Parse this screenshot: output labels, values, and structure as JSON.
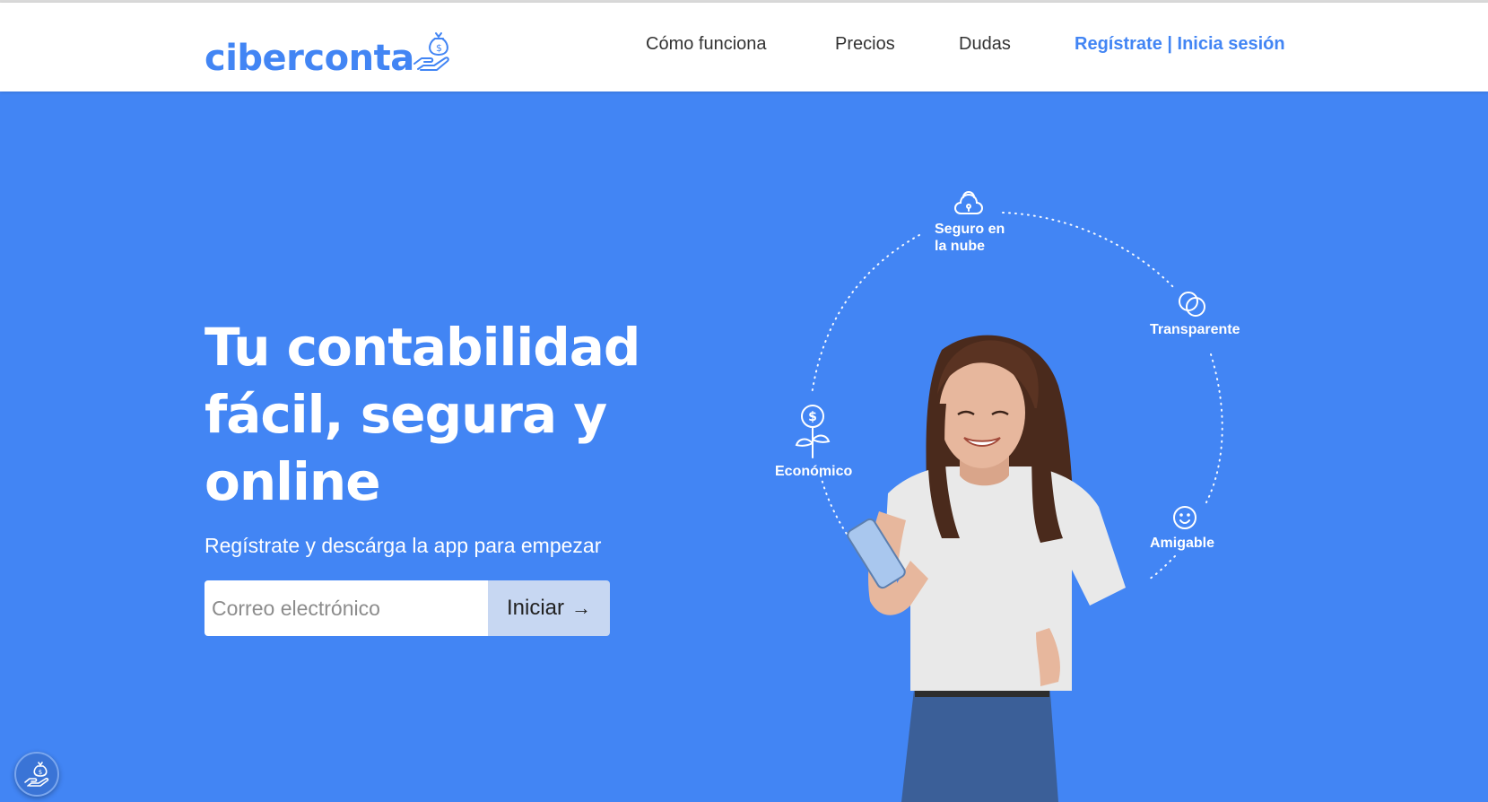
{
  "brand": {
    "name": "ciberconta",
    "logo_icon": "money-bag-hand-icon"
  },
  "nav": {
    "how_it_works": "Cómo funciona",
    "prices": "Precios",
    "faq": "Dudas",
    "auth": "Regístrate | Inicia sesión"
  },
  "hero": {
    "title_lines": [
      "Tu contabilidad",
      "fácil, segura y",
      "online"
    ],
    "subtitle": "Regístrate y descárga la app para empezar",
    "email_placeholder": "Correo electrónico",
    "cta_label": "Iniciar",
    "cta_icon": "arrow-right-icon"
  },
  "features": [
    {
      "label": "Seguro en la nube",
      "icon": "cloud-lock-icon"
    },
    {
      "label": "Transparente",
      "icon": "overlapping-circles-icon"
    },
    {
      "label": "Económico",
      "icon": "money-plant-icon"
    },
    {
      "label": "Amigable",
      "icon": "smiley-icon"
    }
  ],
  "colors": {
    "brand_blue": "#4285f4",
    "header_bg": "#ffffff",
    "cta_bg": "#c7d7f2"
  },
  "floating_button": {
    "icon": "money-bag-hand-icon"
  }
}
